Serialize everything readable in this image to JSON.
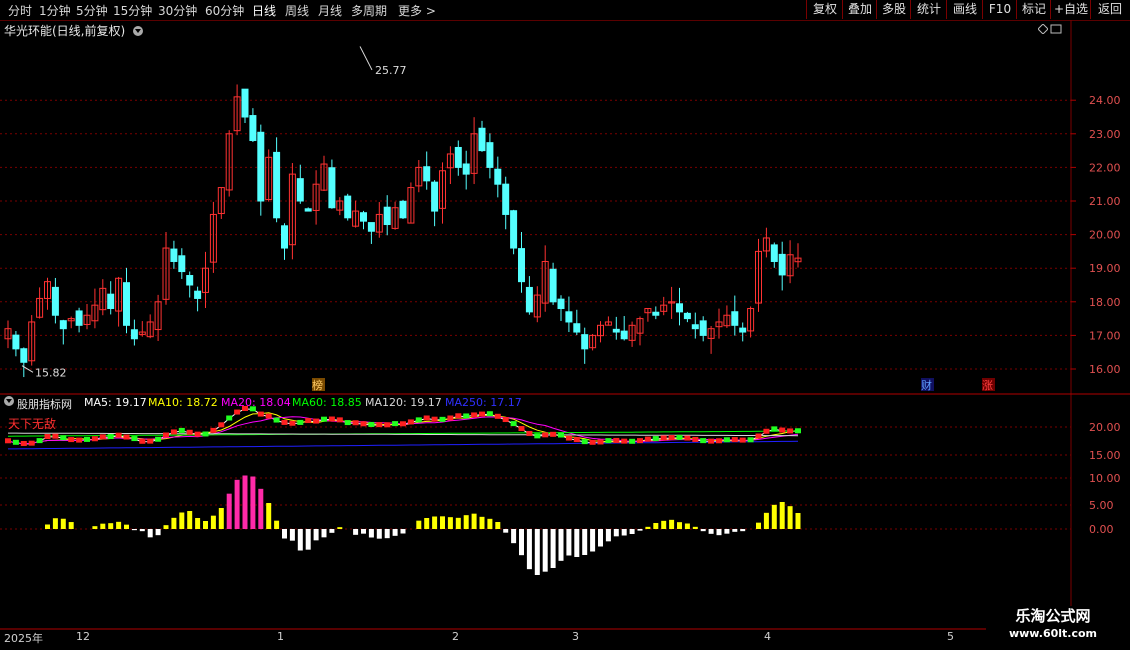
{
  "toolbar": {
    "periods": [
      "分时",
      "1分钟",
      "5分钟",
      "15分钟",
      "30分钟",
      "60分钟",
      "日线",
      "周线",
      "月线",
      "多周期",
      "更多 >"
    ],
    "active_period": "日线",
    "right_buttons": [
      "复权",
      "叠加",
      "多股",
      "统计",
      "画线",
      "F10",
      "标记",
      "+自选",
      "返回"
    ]
  },
  "main": {
    "title": "华光环能(日线,前复权)",
    "high_label": "25.77",
    "low_label": "15.82",
    "y_ticks": [
      "24.00",
      "23.00",
      "22.00",
      "21.00",
      "20.00",
      "19.00",
      "18.00",
      "17.00",
      "16.00"
    ],
    "event_markers": [
      "榜",
      "财",
      "涨"
    ]
  },
  "indicator": {
    "name": "股朋指标网",
    "ma5": "MA5: 19.17",
    "ma10": "MA10: 18.72",
    "ma20": "MA20: 18.04",
    "ma60": "MA60: 18.85",
    "ma120": "MA120: 19.17",
    "ma250": "MA250: 17.17",
    "subtitle": "天下无敌",
    "y_ticks_upper": [
      "20.00",
      "15.00"
    ],
    "y_ticks_lower": [
      "10.00",
      "5.00",
      "0.00"
    ]
  },
  "colors": {
    "up": "#ff3232",
    "down": "#54ffff",
    "ma5": "#ffffff",
    "ma10": "#ffff00",
    "ma20": "#ff00ff",
    "ma60": "#00ff00",
    "ma120": "#d8d8d8",
    "ma250": "#2020ff",
    "hist_magenta": "#ff2aa8",
    "hist_yellow": "#ffff00",
    "hist_white": "#ffffff",
    "grid": "#7a0000"
  },
  "dates": {
    "year": "2025年",
    "months": [
      "12",
      "1",
      "2",
      "3",
      "4",
      "5"
    ]
  },
  "watermark": {
    "title": "乐淘公式网",
    "url": "www.60lt.com"
  }
}
